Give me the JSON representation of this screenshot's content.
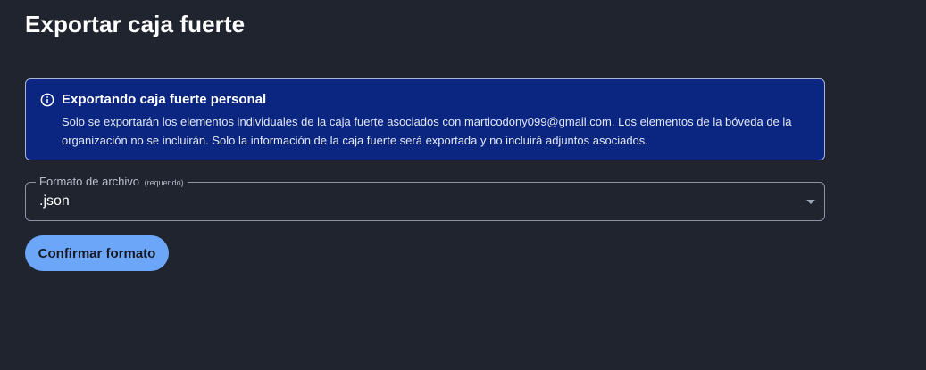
{
  "page": {
    "title": "Exportar caja fuerte"
  },
  "callout": {
    "icon": "info-icon",
    "title": "Exportando caja fuerte personal",
    "text": "Solo se exportarán los elementos individuales de la caja fuerte asociados con marticodony099@gmail.com. Los elementos de la bóveda de la organización no se incluirán. Solo la información de la caja fuerte será exportada y no incluirá adjuntos asociados."
  },
  "format_field": {
    "label": "Formato de archivo",
    "required_label": "(requerido)",
    "value": ".json",
    "icon": "chevron-down-icon"
  },
  "actions": {
    "confirm_label": "Confirmar formato"
  },
  "colors": {
    "background": "#1f242f",
    "callout_background": "#0b2680",
    "primary_button": "#6ba6f9"
  }
}
